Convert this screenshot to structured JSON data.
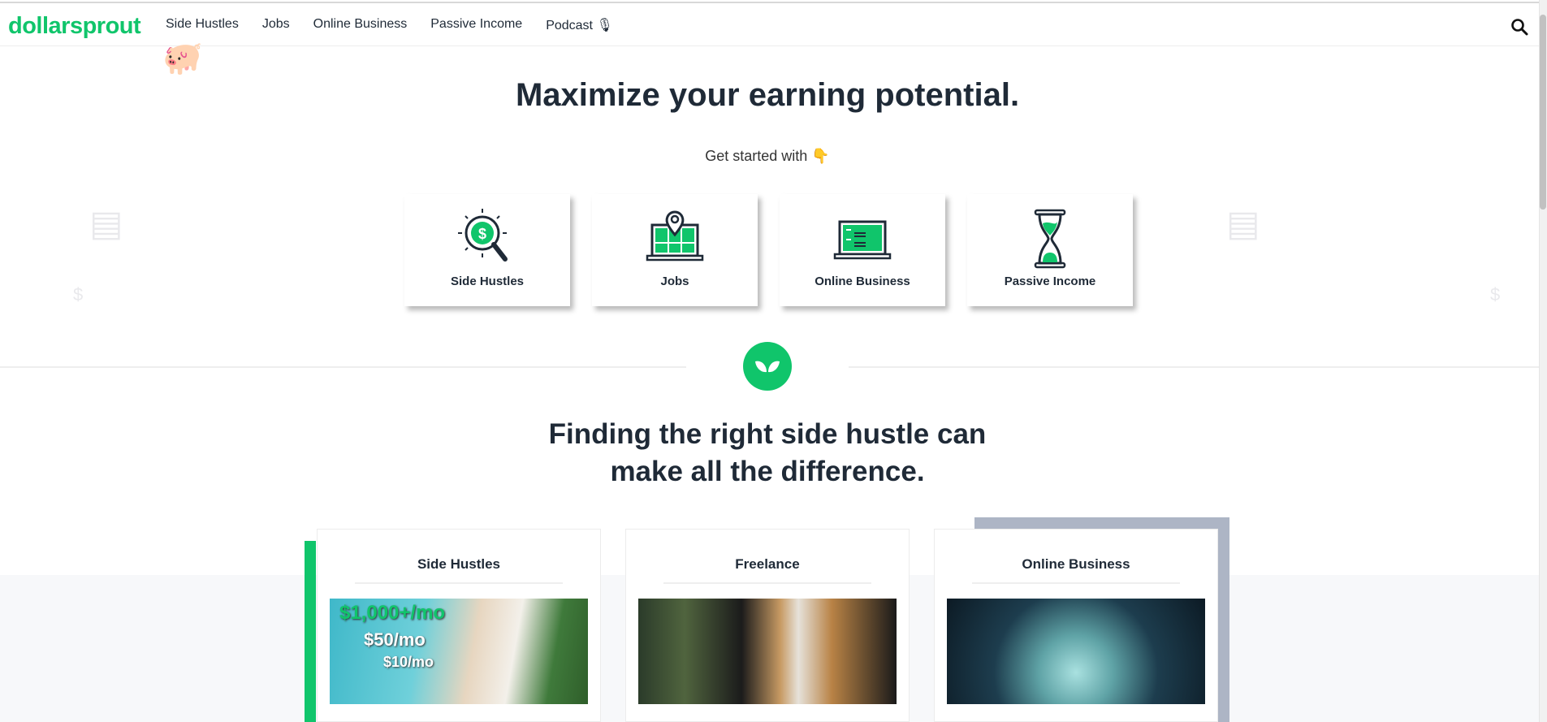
{
  "header": {
    "logo": "dollarsprout",
    "nav": [
      "Side Hustles",
      "Jobs",
      "Online Business",
      "Passive Income",
      "Podcast 🎙"
    ]
  },
  "hero": {
    "title": "Maximize your earning potential.",
    "subtitle": "Get started with 👇",
    "categories": [
      {
        "label": "Side Hustles",
        "icon": "dollar-magnifier-icon"
      },
      {
        "label": "Jobs",
        "icon": "map-pin-laptop-icon"
      },
      {
        "label": "Online Business",
        "icon": "laptop-code-icon"
      },
      {
        "label": "Passive Income",
        "icon": "hourglass-icon"
      }
    ]
  },
  "section": {
    "title_line1": "Finding the right side hustle can",
    "title_line2": "make all the difference.",
    "cards": [
      {
        "title": "Side Hustles",
        "image_text": [
          "$1,000+/mo",
          "$50/mo",
          "$10/mo"
        ]
      },
      {
        "title": "Freelance"
      },
      {
        "title": "Online Business"
      }
    ]
  },
  "colors": {
    "brand": "#10c56b",
    "text": "#1f2a37"
  }
}
